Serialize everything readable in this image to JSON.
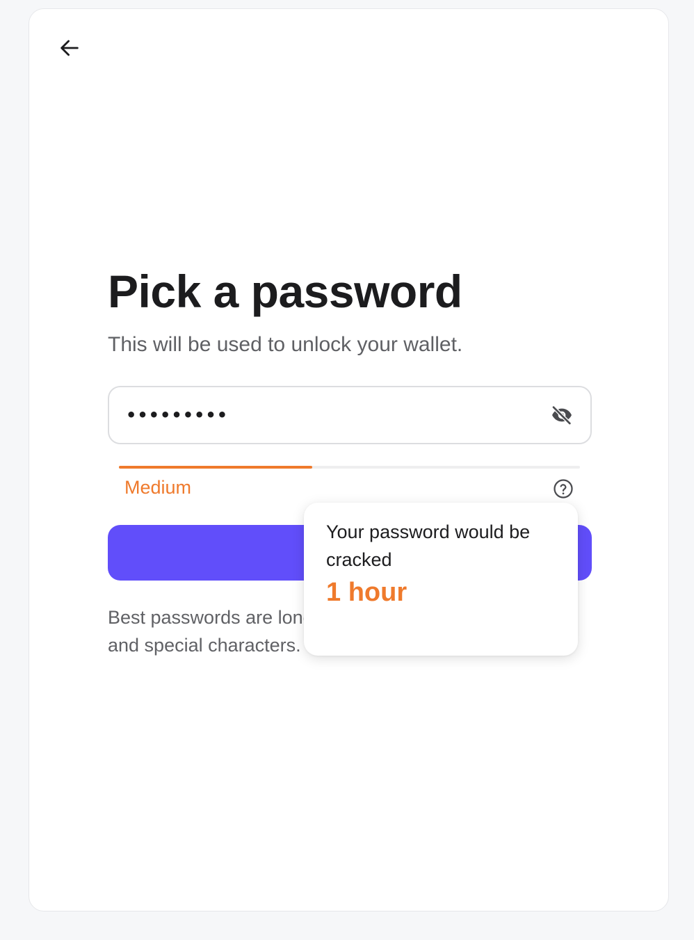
{
  "page": {
    "title": "Pick a password",
    "subtitle": "This will be used to unlock your wallet."
  },
  "password_field": {
    "value": "•••••••••",
    "visibility_icon": "eye-slash-icon"
  },
  "strength": {
    "label": "Medium",
    "level": 0.42,
    "color": "#ef7a2c",
    "help_icon": "question-circle-icon"
  },
  "primary_button": {
    "label": "",
    "color": "#614efa"
  },
  "hint": {
    "text": "Best passwords are long and contain letters, numbers and special characters."
  },
  "tooltip": {
    "text": "Your password would be cracked",
    "time": "1 hour"
  },
  "icons": {
    "back": "arrow-left-icon"
  }
}
